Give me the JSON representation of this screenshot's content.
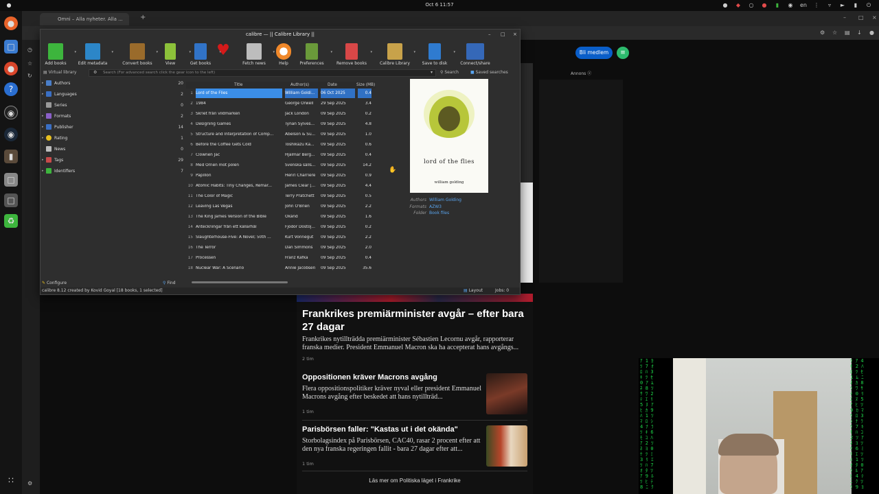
{
  "system": {
    "activities": "●",
    "clock": "Oct 6  11:57",
    "tray_icons": [
      "user-icon",
      "shield-icon",
      "ghost-icon",
      "red-circle-icon",
      "green-bottle-icon",
      "steam-icon",
      "lang-indicator",
      "bluetooth-icon",
      "wifi-icon",
      "volume-icon",
      "battery-icon",
      "power-icon"
    ],
    "lang": "en"
  },
  "browser": {
    "tab_title": "Omni – Alla nyheter. Alla ...",
    "new_tab": "+",
    "minimize": "–",
    "maximize": "□",
    "close": "×"
  },
  "calibre": {
    "window_title": "calibre — || Calibre Library ||",
    "toolbar": [
      {
        "label": "Add books",
        "color": "#3db53d"
      },
      {
        "label": "Edit metadata",
        "color": "#2c86c8"
      },
      {
        "label": "Convert books",
        "color": "#9a6b2b"
      },
      {
        "label": "View",
        "color": "#8cc13a"
      },
      {
        "label": "Get books",
        "color": "#3173c7"
      },
      {
        "label": "",
        "color": "#d41a1a"
      },
      {
        "label": "Fetch news",
        "color": "#bdbdbd"
      },
      {
        "label": "Help",
        "color": "#f0882a"
      },
      {
        "label": "Preferences",
        "color": "#6a9a3a"
      },
      {
        "label": "Remove books",
        "color": "#d84747"
      },
      {
        "label": "Calibre Library",
        "color": "#c8a24a"
      },
      {
        "label": "Save to disk",
        "color": "#2f7bd0"
      },
      {
        "label": "Connect/share",
        "color": "#3568b8"
      }
    ],
    "virtual_library": "Virtual library",
    "search_placeholder": "Search (For advanced search click the gear icon to the left)",
    "search_button": "Search",
    "saved_searches": "Saved searches",
    "tag_browser": [
      {
        "label": "Authors",
        "count": "20",
        "color": "#4a7ec8"
      },
      {
        "label": "Languages",
        "count": "2",
        "color": "#3a6fc4"
      },
      {
        "label": "Series",
        "count": "0",
        "color": "#9a9a9a"
      },
      {
        "label": "Formats",
        "count": "2",
        "color": "#8a5fc8"
      },
      {
        "label": "Publisher",
        "count": "14",
        "color": "#3a6fc4"
      },
      {
        "label": "Rating",
        "count": "1",
        "color": "#e8c020"
      },
      {
        "label": "News",
        "count": "0",
        "color": "#bdbdbd"
      },
      {
        "label": "Tags",
        "count": "29",
        "color": "#c84a4a"
      },
      {
        "label": "Identifiers",
        "count": "7",
        "color": "#3db53d"
      }
    ],
    "columns": {
      "title": "Title",
      "authors": "Author(s)",
      "date": "Date",
      "size": "Size (MB)"
    },
    "books": [
      {
        "n": "1",
        "title": "Lord of the Flies",
        "author": "William Goldi...",
        "date": "06 Oct 2025",
        "size": "0.4"
      },
      {
        "n": "2",
        "title": "1984",
        "author": "George Orwell",
        "date": "29 Sep 2025",
        "size": "3.4"
      },
      {
        "n": "3",
        "title": "Skriet från vildmarken",
        "author": "Jack London",
        "date": "09 Sep 2025",
        "size": "0.2"
      },
      {
        "n": "4",
        "title": "Designing Games",
        "author": "Tynan Sylves...",
        "date": "09 Sep 2025",
        "size": "4.8"
      },
      {
        "n": "5",
        "title": "Structure and Interpretation of Comp...",
        "author": "Abelson & Su...",
        "date": "09 Sep 2025",
        "size": "1.0"
      },
      {
        "n": "6",
        "title": "Before the Coffee Gets Cold",
        "author": "Toshikazu Ka...",
        "date": "09 Sep 2025",
        "size": "0.6"
      },
      {
        "n": "7",
        "title": "Clownen Jac",
        "author": "Hjalmar Berg...",
        "date": "09 Sep 2025",
        "size": "0.4"
      },
      {
        "n": "8",
        "title": "Med Örnen mot polen",
        "author": "Svenska sälls...",
        "date": "09 Sep 2025",
        "size": "14.2"
      },
      {
        "n": "9",
        "title": "Papillon",
        "author": "Henri Charriere",
        "date": "09 Sep 2025",
        "size": "0.9"
      },
      {
        "n": "10",
        "title": "Atomic Habits: Tiny Changes, Remar...",
        "author": "James Clear [...",
        "date": "09 Sep 2025",
        "size": "4.4"
      },
      {
        "n": "11",
        "title": "The Color of Magic",
        "author": "Terry Pratchett",
        "date": "09 Sep 2025",
        "size": "0.5"
      },
      {
        "n": "12",
        "title": "Leaving Las Vegas",
        "author": "John O'Brien",
        "date": "09 Sep 2025",
        "size": "2.2"
      },
      {
        "n": "13",
        "title": "The King James Version of the Bible",
        "author": "Okänd",
        "date": "09 Sep 2025",
        "size": "1.6"
      },
      {
        "n": "14",
        "title": "Anteckningar från ett källarhål",
        "author": "Fjodor Dostoj...",
        "date": "09 Sep 2025",
        "size": "0.2"
      },
      {
        "n": "15",
        "title": "Slaughterhouse-Five: A Novel; 50th ...",
        "author": "Kurt Vonnegut",
        "date": "09 Sep 2025",
        "size": "2.2"
      },
      {
        "n": "16",
        "title": "The Terror",
        "author": "Dan Simmons",
        "date": "09 Sep 2025",
        "size": "2.0"
      },
      {
        "n": "17",
        "title": "Processen",
        "author": "Franz Kafka",
        "date": "09 Sep 2025",
        "size": "0.4"
      },
      {
        "n": "18",
        "title": "Nuclear War: A Scenario",
        "author": "Annie Jacobsen",
        "date": "09 Sep 2025",
        "size": "35.6"
      }
    ],
    "cover": {
      "title": "lord of the flies",
      "author": "william golding"
    },
    "details": {
      "authors_label": "Authors",
      "authors_value": "William Golding",
      "formats_label": "Formats",
      "formats_value": "AZW3",
      "folder_label": "Folder",
      "folder_value": "Book files"
    },
    "configure": "Configure",
    "find": "Find",
    "layout": "Layout",
    "jobs": "Jobs: 0",
    "status": "calibre 8.12 created by Kovid Goyal   [18 books, 1 selected]"
  },
  "web": {
    "bli_medlem": "Bli medlem",
    "annons": "Annons ⓧ",
    "headline": "Frankrikes premiärminister avgår – efter bara 27 dagar",
    "lead": "Frankrikes nytillträdda premiärminister Sébastien Lecornu avgår, rapporterar franska medier. President Emmanuel Macron ska ha accepterat hans avgångs...",
    "lead_time": "2 tim",
    "story2_title": "Oppositionen kräver Macrons avgång",
    "story2_body": "Flera oppositionspolitiker kräver nyval eller president Emmanuel Macrons avgång efter beskedet att hans nytillträd...",
    "story2_time": "1 tim",
    "story3_title": "Parisbörsen faller: \"Kastas ut i det okända\"",
    "story3_body": "Storbolagsindex på Parisbörsen, CAC40, rasar 2 procent efter att den nya franska regeringen fallit - bara 27 dagar efter att...",
    "story3_time": "1 tim",
    "more_link": "Läs mer om Politiska läget i Frankrike"
  }
}
